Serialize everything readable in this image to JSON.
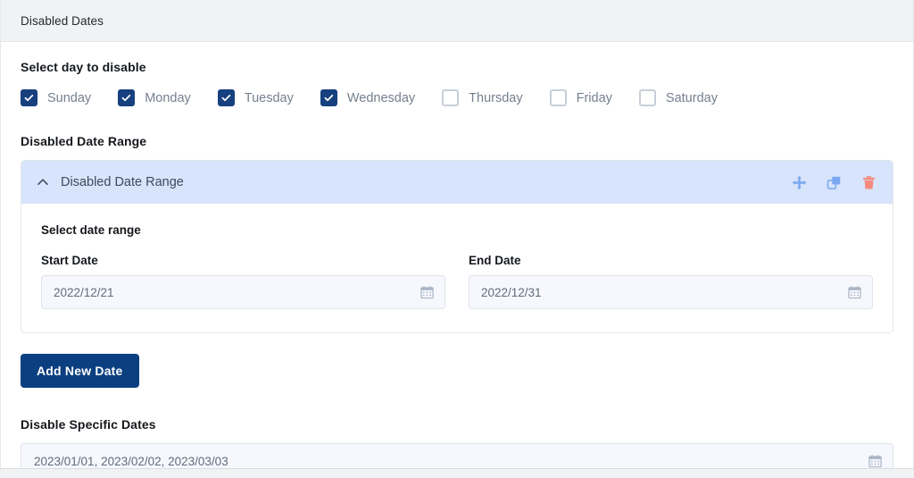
{
  "titlebar": {
    "title": "Disabled Dates"
  },
  "days_section": {
    "label": "Select day to disable",
    "items": [
      {
        "label": "Sunday",
        "checked": true,
        "icon": "checkbox-checked-icon"
      },
      {
        "label": "Monday",
        "checked": true,
        "icon": "checkbox-checked-icon"
      },
      {
        "label": "Tuesday",
        "checked": true,
        "icon": "checkbox-checked-icon"
      },
      {
        "label": "Wednesday",
        "checked": true,
        "icon": "checkbox-checked-icon"
      },
      {
        "label": "Thursday",
        "checked": false,
        "icon": "checkbox-unchecked-icon"
      },
      {
        "label": "Friday",
        "checked": false,
        "icon": "checkbox-unchecked-icon"
      },
      {
        "label": "Saturday",
        "checked": false,
        "icon": "checkbox-unchecked-icon"
      }
    ]
  },
  "range_section": {
    "label": "Disabled Date Range",
    "card": {
      "header_title": "Disabled Date Range",
      "collapse_icon": "chevron-up-icon",
      "actions": [
        {
          "name": "move-icon",
          "title": "Move"
        },
        {
          "name": "duplicate-icon",
          "title": "Duplicate"
        },
        {
          "name": "delete-icon",
          "title": "Delete"
        }
      ],
      "body_label": "Select date range",
      "fields": [
        {
          "label": "Start Date",
          "value": "2022/12/21",
          "placeholder": "2022/12/21",
          "icon": "calendar-icon"
        },
        {
          "label": "End Date",
          "value": "2022/12/31",
          "placeholder": "2022/12/31",
          "icon": "calendar-icon"
        }
      ]
    },
    "add_button_label": "Add New Date"
  },
  "specific_section": {
    "label": "Disable Specific Dates",
    "value": "2023/01/01, 2023/02/02, 2023/03/03",
    "placeholder": "2023/01/01, 2023/02/02, 2023/03/03",
    "icon": "calendar-icon"
  },
  "colors": {
    "titlebar_bg": "#f1f2f4",
    "checkbox_checked": "#17407e",
    "checkbox_border": "#c8cfda",
    "card_header_bg": "#d7e4fb",
    "action_blue": "#7aa8f0",
    "delete_red": "#f58a7e",
    "button_bg": "#0b3f80",
    "input_bg": "#f6f8fd",
    "input_border": "#dfe3ec",
    "label_text": "#15181c",
    "muted_text": "#76808f"
  }
}
